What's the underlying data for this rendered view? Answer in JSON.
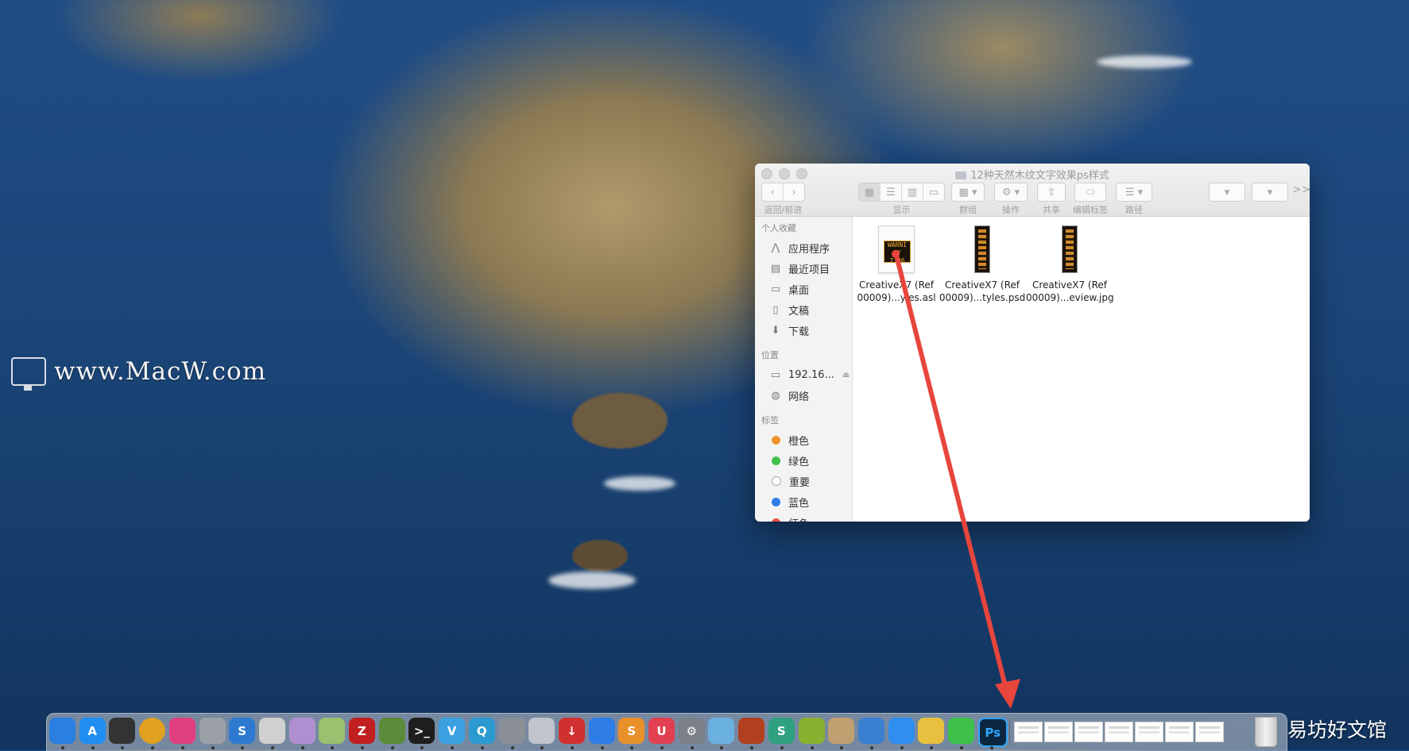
{
  "watermark": {
    "text": "www.MacW.com"
  },
  "finder": {
    "title": "12种天然木纹文字效果ps样式",
    "toolbar": {
      "back_forward_label": "返回/前进",
      "view_label": "显示",
      "group_label": "群组",
      "action_label": "操作",
      "share_label": "共享",
      "edit_tags_label": "编辑标签",
      "path_label": "路径",
      "more_label": ">>"
    },
    "sidebar": {
      "favorites_header": "个人收藏",
      "favorites": [
        {
          "label": "应用程序",
          "icon": "applications-icon"
        },
        {
          "label": "最近项目",
          "icon": "recents-icon"
        },
        {
          "label": "桌面",
          "icon": "desktop-icon"
        },
        {
          "label": "文稿",
          "icon": "documents-icon"
        },
        {
          "label": "下载",
          "icon": "downloads-icon"
        }
      ],
      "locations_header": "位置",
      "locations": [
        {
          "label": "192.16...",
          "icon": "computer-icon"
        },
        {
          "label": "网络",
          "icon": "network-icon"
        }
      ],
      "tags_header": "标签",
      "tags": [
        {
          "label": "橙色",
          "color": "#f0952e"
        },
        {
          "label": "绿色",
          "color": "#3fc04a"
        },
        {
          "label": "重要",
          "color": "#ffffff"
        },
        {
          "label": "蓝色",
          "color": "#2f7ee8"
        },
        {
          "label": "红色",
          "color": "#e94c43"
        }
      ]
    },
    "files": [
      {
        "line1": "CreativeX7 (Ref",
        "line2": "00009)...yles.asl",
        "thumb_text": "WARNI LY 7:36"
      },
      {
        "line1": "CreativeX7 (Ref",
        "line2": "00009)...tyles.psd"
      },
      {
        "line1": "CreativeX7 (Ref",
        "line2": "00009)...eview.jpg"
      }
    ]
  },
  "dock": {
    "apps": [
      {
        "name": "finder-icon",
        "glyph": "",
        "color": "#2a7fe0"
      },
      {
        "name": "app-store-icon",
        "glyph": "A",
        "color": "#1f8ef0"
      },
      {
        "name": "final-cut-icon",
        "glyph": "",
        "color": "#333333"
      },
      {
        "name": "chrome-icon",
        "glyph": "",
        "color": "#e0a020"
      },
      {
        "name": "color-picker-icon",
        "glyph": "",
        "color": "#e04080"
      },
      {
        "name": "printer-icon",
        "glyph": "",
        "color": "#9aa0a6"
      },
      {
        "name": "s-app-icon",
        "glyph": "S",
        "color": "#2e7ad0"
      },
      {
        "name": "screen-icon",
        "glyph": "",
        "color": "#d0d0d0"
      },
      {
        "name": "palette-icon",
        "glyph": "",
        "color": "#b08fd0"
      },
      {
        "name": "drink-icon",
        "glyph": "",
        "color": "#9bc070"
      },
      {
        "name": "filezilla-icon",
        "glyph": "Z",
        "color": "#c02020"
      },
      {
        "name": "image-app-icon",
        "glyph": "",
        "color": "#5a8a3a"
      },
      {
        "name": "terminal-icon",
        "glyph": ">_",
        "color": "#1e1e1e"
      },
      {
        "name": "v-app-icon",
        "glyph": "V",
        "color": "#3aa0e0"
      },
      {
        "name": "search-app-icon",
        "glyph": "Q",
        "color": "#2a9ad0"
      },
      {
        "name": "launchpad-icon",
        "glyph": "",
        "color": "#8a8f98"
      },
      {
        "name": "robot-icon",
        "glyph": "",
        "color": "#c0c4cc"
      },
      {
        "name": "download-app-icon",
        "glyph": "↓",
        "color": "#d03030"
      },
      {
        "name": "airmail-icon",
        "glyph": "",
        "color": "#2f7ee8"
      },
      {
        "name": "sublime-icon",
        "glyph": "S",
        "color": "#e8902a"
      },
      {
        "name": "magnet-icon",
        "glyph": "U",
        "color": "#e04050"
      },
      {
        "name": "system-preferences-icon",
        "glyph": "⚙",
        "color": "#7a7f88"
      },
      {
        "name": "preview-icon",
        "glyph": "",
        "color": "#6ab0e0"
      },
      {
        "name": "photo-booth-icon",
        "glyph": "",
        "color": "#b04020"
      },
      {
        "name": "s-circle-icon",
        "glyph": "S",
        "color": "#2fa080"
      },
      {
        "name": "lime-icon",
        "glyph": "",
        "color": "#8ab030"
      },
      {
        "name": "archive-icon",
        "glyph": "",
        "color": "#c0a070"
      },
      {
        "name": "xcode-tools-icon",
        "glyph": "",
        "color": "#3a80d0"
      },
      {
        "name": "baidu-netdisk-icon",
        "glyph": "",
        "color": "#2f8ef0"
      },
      {
        "name": "notes-icon",
        "glyph": "",
        "color": "#e8c040"
      },
      {
        "name": "wechat-icon",
        "glyph": "",
        "color": "#3fc04a"
      },
      {
        "name": "photoshop-icon",
        "glyph": "Ps",
        "color": "#0b2740"
      }
    ],
    "trash_label": "trash-icon"
  },
  "corner_watermark": "易坊好文馆"
}
